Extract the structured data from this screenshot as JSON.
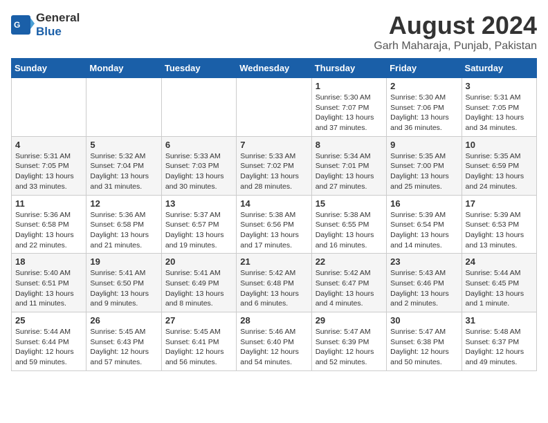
{
  "header": {
    "logo_general": "General",
    "logo_blue": "Blue",
    "month": "August 2024",
    "location": "Garh Maharaja, Punjab, Pakistan"
  },
  "days_of_week": [
    "Sunday",
    "Monday",
    "Tuesday",
    "Wednesday",
    "Thursday",
    "Friday",
    "Saturday"
  ],
  "weeks": [
    [
      {
        "day": "",
        "info": ""
      },
      {
        "day": "",
        "info": ""
      },
      {
        "day": "",
        "info": ""
      },
      {
        "day": "",
        "info": ""
      },
      {
        "day": "1",
        "info": "Sunrise: 5:30 AM\nSunset: 7:07 PM\nDaylight: 13 hours\nand 37 minutes."
      },
      {
        "day": "2",
        "info": "Sunrise: 5:30 AM\nSunset: 7:06 PM\nDaylight: 13 hours\nand 36 minutes."
      },
      {
        "day": "3",
        "info": "Sunrise: 5:31 AM\nSunset: 7:05 PM\nDaylight: 13 hours\nand 34 minutes."
      }
    ],
    [
      {
        "day": "4",
        "info": "Sunrise: 5:31 AM\nSunset: 7:05 PM\nDaylight: 13 hours\nand 33 minutes."
      },
      {
        "day": "5",
        "info": "Sunrise: 5:32 AM\nSunset: 7:04 PM\nDaylight: 13 hours\nand 31 minutes."
      },
      {
        "day": "6",
        "info": "Sunrise: 5:33 AM\nSunset: 7:03 PM\nDaylight: 13 hours\nand 30 minutes."
      },
      {
        "day": "7",
        "info": "Sunrise: 5:33 AM\nSunset: 7:02 PM\nDaylight: 13 hours\nand 28 minutes."
      },
      {
        "day": "8",
        "info": "Sunrise: 5:34 AM\nSunset: 7:01 PM\nDaylight: 13 hours\nand 27 minutes."
      },
      {
        "day": "9",
        "info": "Sunrise: 5:35 AM\nSunset: 7:00 PM\nDaylight: 13 hours\nand 25 minutes."
      },
      {
        "day": "10",
        "info": "Sunrise: 5:35 AM\nSunset: 6:59 PM\nDaylight: 13 hours\nand 24 minutes."
      }
    ],
    [
      {
        "day": "11",
        "info": "Sunrise: 5:36 AM\nSunset: 6:58 PM\nDaylight: 13 hours\nand 22 minutes."
      },
      {
        "day": "12",
        "info": "Sunrise: 5:36 AM\nSunset: 6:58 PM\nDaylight: 13 hours\nand 21 minutes."
      },
      {
        "day": "13",
        "info": "Sunrise: 5:37 AM\nSunset: 6:57 PM\nDaylight: 13 hours\nand 19 minutes."
      },
      {
        "day": "14",
        "info": "Sunrise: 5:38 AM\nSunset: 6:56 PM\nDaylight: 13 hours\nand 17 minutes."
      },
      {
        "day": "15",
        "info": "Sunrise: 5:38 AM\nSunset: 6:55 PM\nDaylight: 13 hours\nand 16 minutes."
      },
      {
        "day": "16",
        "info": "Sunrise: 5:39 AM\nSunset: 6:54 PM\nDaylight: 13 hours\nand 14 minutes."
      },
      {
        "day": "17",
        "info": "Sunrise: 5:39 AM\nSunset: 6:53 PM\nDaylight: 13 hours\nand 13 minutes."
      }
    ],
    [
      {
        "day": "18",
        "info": "Sunrise: 5:40 AM\nSunset: 6:51 PM\nDaylight: 13 hours\nand 11 minutes."
      },
      {
        "day": "19",
        "info": "Sunrise: 5:41 AM\nSunset: 6:50 PM\nDaylight: 13 hours\nand 9 minutes."
      },
      {
        "day": "20",
        "info": "Sunrise: 5:41 AM\nSunset: 6:49 PM\nDaylight: 13 hours\nand 8 minutes."
      },
      {
        "day": "21",
        "info": "Sunrise: 5:42 AM\nSunset: 6:48 PM\nDaylight: 13 hours\nand 6 minutes."
      },
      {
        "day": "22",
        "info": "Sunrise: 5:42 AM\nSunset: 6:47 PM\nDaylight: 13 hours\nand 4 minutes."
      },
      {
        "day": "23",
        "info": "Sunrise: 5:43 AM\nSunset: 6:46 PM\nDaylight: 13 hours\nand 2 minutes."
      },
      {
        "day": "24",
        "info": "Sunrise: 5:44 AM\nSunset: 6:45 PM\nDaylight: 13 hours\nand 1 minute."
      }
    ],
    [
      {
        "day": "25",
        "info": "Sunrise: 5:44 AM\nSunset: 6:44 PM\nDaylight: 12 hours\nand 59 minutes."
      },
      {
        "day": "26",
        "info": "Sunrise: 5:45 AM\nSunset: 6:43 PM\nDaylight: 12 hours\nand 57 minutes."
      },
      {
        "day": "27",
        "info": "Sunrise: 5:45 AM\nSunset: 6:41 PM\nDaylight: 12 hours\nand 56 minutes."
      },
      {
        "day": "28",
        "info": "Sunrise: 5:46 AM\nSunset: 6:40 PM\nDaylight: 12 hours\nand 54 minutes."
      },
      {
        "day": "29",
        "info": "Sunrise: 5:47 AM\nSunset: 6:39 PM\nDaylight: 12 hours\nand 52 minutes."
      },
      {
        "day": "30",
        "info": "Sunrise: 5:47 AM\nSunset: 6:38 PM\nDaylight: 12 hours\nand 50 minutes."
      },
      {
        "day": "31",
        "info": "Sunrise: 5:48 AM\nSunset: 6:37 PM\nDaylight: 12 hours\nand 49 minutes."
      }
    ]
  ]
}
